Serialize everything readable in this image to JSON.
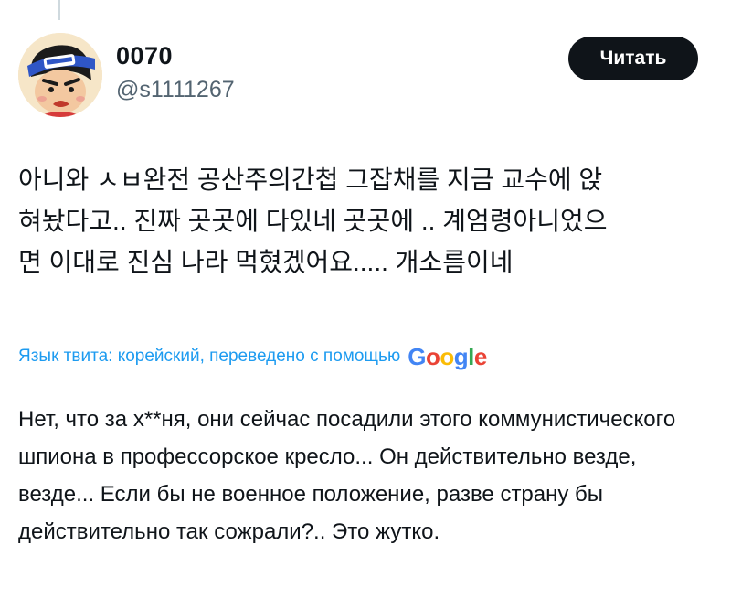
{
  "tweet": {
    "author": {
      "display_name": "0070",
      "handle": "@s1111267",
      "avatar_icon": "cartoon-avatar-icon"
    },
    "follow_button_label": "Читать",
    "text": "아니와 ㅅㅂ완전 공산주의간첩 그잡채를 지금 교수에 앉\n혀놨다고.. 진짜 곳곳에 다있네 곳곳에 .. 계엄령아니었으\n면 이대로 진심 나라 먹혔겠어요..... 개소름이네",
    "translation": {
      "label": "Язык твита: корейский, переведено с помощью",
      "provider_letters": [
        "G",
        "o",
        "o",
        "g",
        "l",
        "e"
      ],
      "provider_colors": [
        "#4285F4",
        "#EA4335",
        "#FBBC05",
        "#4285F4",
        "#34A853",
        "#EA4335"
      ],
      "text": "Нет, что за х**ня, они сейчас посадили этого коммунистического шпиона в профессорское кресло... Он действительно везде, везде... Если бы не военное положение, разве страну бы действительно так сожрали?.. Это жутко."
    }
  },
  "colors": {
    "text_primary": "#0f1419",
    "text_secondary": "#536471",
    "link": "#1d9bf0",
    "button_bg": "#0f1419",
    "button_text": "#ffffff",
    "thread_line": "#cfd9de"
  }
}
